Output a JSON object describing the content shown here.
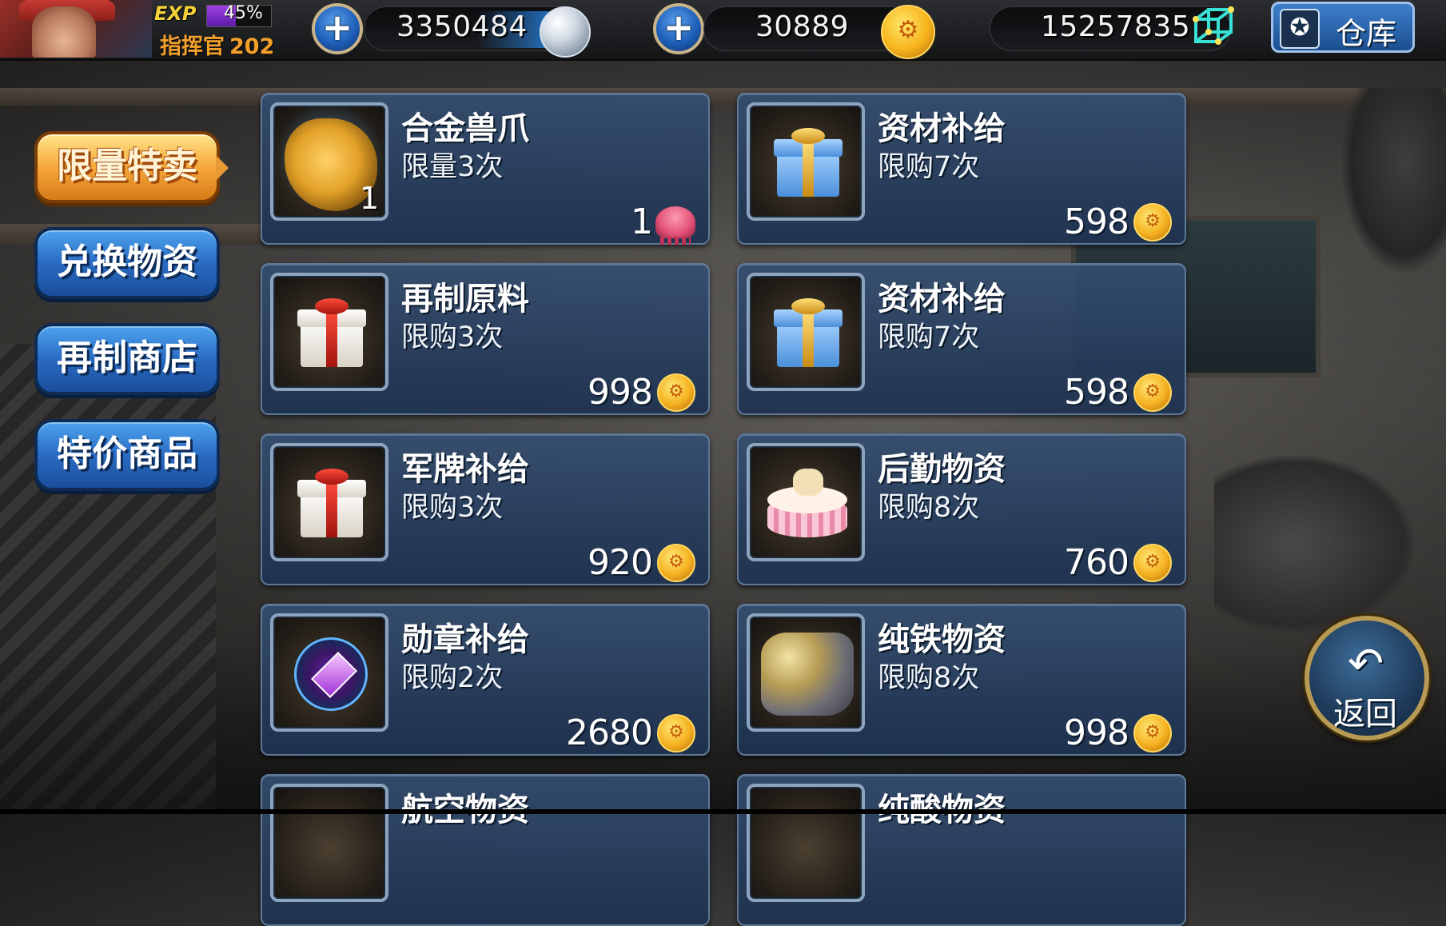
{
  "player": {
    "exp_label": "EXP",
    "exp_percent": "45%",
    "exp_fraction": 0.45,
    "rank_label": "指挥官",
    "level": "202"
  },
  "resources": {
    "silver": "3350484",
    "gold": "30889",
    "cube": "15257835",
    "add_label": "+"
  },
  "warehouse": {
    "label": "仓库"
  },
  "sidebar": {
    "items": [
      {
        "label": "限量特卖",
        "active": true
      },
      {
        "label": "兑换物资",
        "active": false
      },
      {
        "label": "再制商店",
        "active": false
      },
      {
        "label": "特价商品",
        "active": false
      }
    ]
  },
  "shop": {
    "items": [
      {
        "name": "合金兽爪",
        "limit": "限量3次",
        "price": "1",
        "currency": "jelly-icon",
        "count": "1",
        "icon": "claw-icon"
      },
      {
        "name": "资材补给",
        "limit": "限购7次",
        "price": "598",
        "currency": "gold-coin-icon",
        "icon": "blue-gift-icon"
      },
      {
        "name": "再制原料",
        "limit": "限购3次",
        "price": "998",
        "currency": "gold-coin-icon",
        "icon": "red-gift-icon"
      },
      {
        "name": "资材补给",
        "limit": "限购7次",
        "price": "598",
        "currency": "gold-coin-icon",
        "icon": "blue-gift-icon"
      },
      {
        "name": "军牌补给",
        "limit": "限购3次",
        "price": "920",
        "currency": "gold-coin-icon",
        "icon": "red-gift-icon"
      },
      {
        "name": "后勤物资",
        "limit": "限购8次",
        "price": "760",
        "currency": "gold-coin-icon",
        "icon": "cake-gift-icon"
      },
      {
        "name": "勋章补给",
        "limit": "限购2次",
        "price": "2680",
        "currency": "gold-coin-icon",
        "icon": "medal-icon"
      },
      {
        "name": "纯铁物资",
        "limit": "限购8次",
        "price": "998",
        "currency": "gold-coin-icon",
        "icon": "ore-icon"
      },
      {
        "name": "航空物资",
        "limit": "",
        "price": "",
        "currency": "",
        "icon": "star-item-icon"
      },
      {
        "name": "纯酸物资",
        "limit": "",
        "price": "",
        "currency": "",
        "icon": "flask-item-icon"
      }
    ]
  },
  "back": {
    "label": "返回"
  },
  "colors": {
    "card_bg": "#2f4a6e",
    "gold": "#f5b120",
    "active_tab": "#f6a83a",
    "tab": "#2a6bc3"
  }
}
